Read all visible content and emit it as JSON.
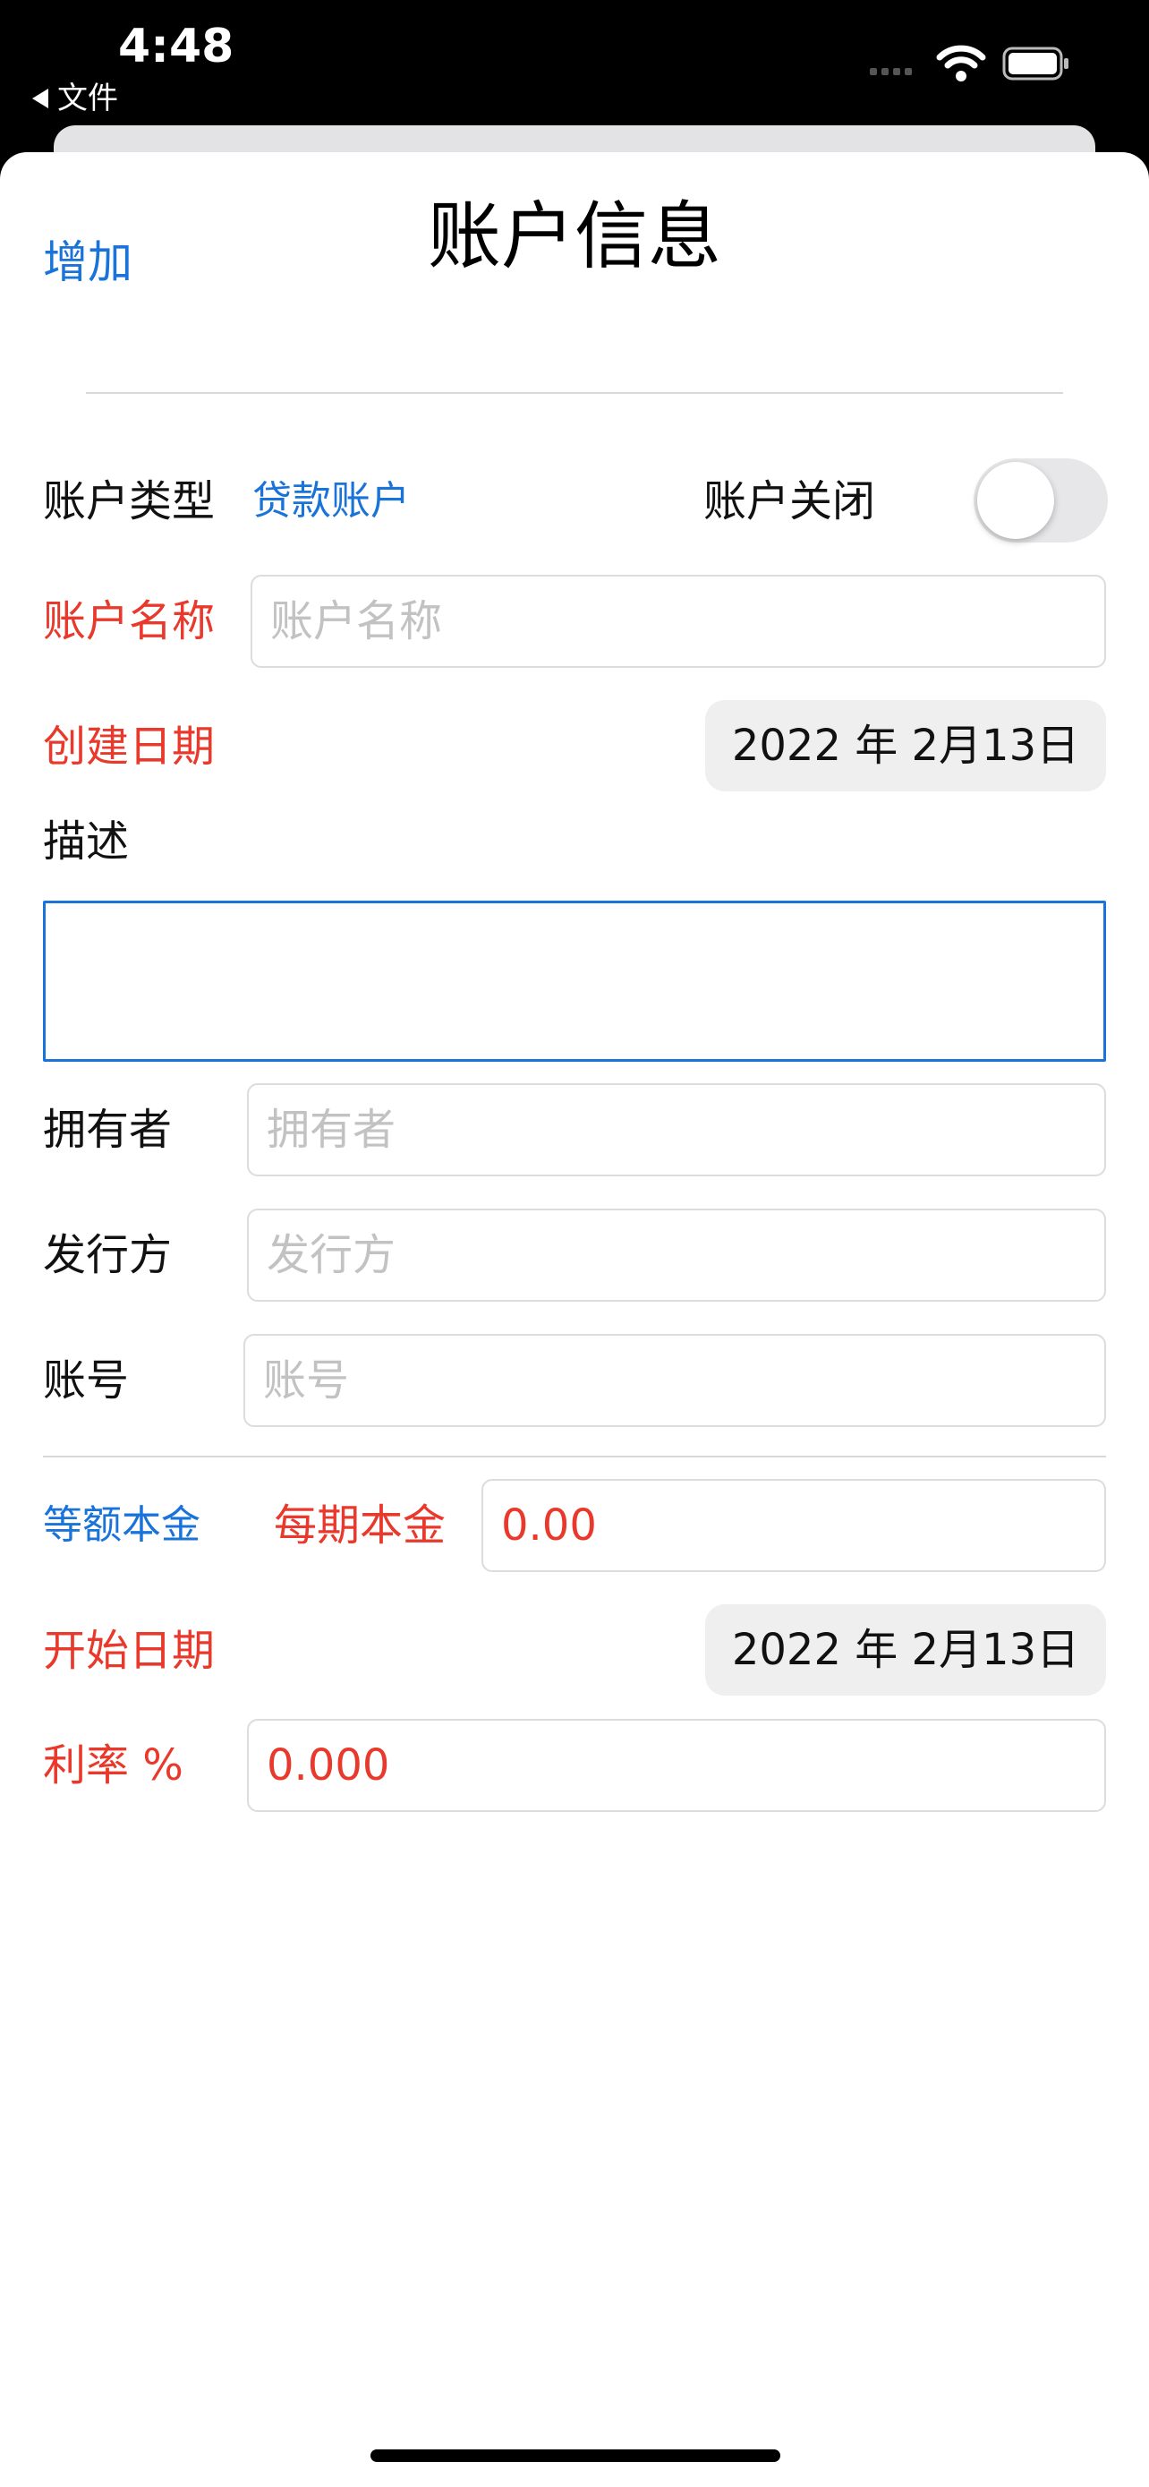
{
  "status_bar": {
    "time": "4:48",
    "back_label": "文件",
    "icons": [
      "signal-icon",
      "wifi-icon",
      "battery-icon"
    ]
  },
  "header": {
    "add_label": "增加",
    "title": "账户信息"
  },
  "form": {
    "account_type": {
      "label": "账户类型",
      "value": "贷款账户"
    },
    "account_closed": {
      "label": "账户关闭",
      "on": false
    },
    "account_name": {
      "label": "账户名称",
      "placeholder": "账户名称"
    },
    "create_date": {
      "label": "创建日期",
      "value": "2022 年 2月13日"
    },
    "description": {
      "label": "描述",
      "value": ""
    },
    "owner": {
      "label": "拥有者",
      "placeholder": "拥有者"
    },
    "issuer": {
      "label": "发行方",
      "placeholder": "发行方"
    },
    "account_number": {
      "label": "账号",
      "placeholder": "账号"
    },
    "repayment": {
      "method": "等额本金",
      "principal_label": "每期本金",
      "principal_value": "0.00"
    },
    "start_date": {
      "label": "开始日期",
      "value": "2022 年 2月13日"
    },
    "rate": {
      "label": "利率 %",
      "value": "0.000"
    }
  },
  "colors": {
    "accent": "#1a73d9",
    "required": "#e8392c",
    "toggle_off": "#e7e7e9",
    "date_bg": "#efefef"
  }
}
